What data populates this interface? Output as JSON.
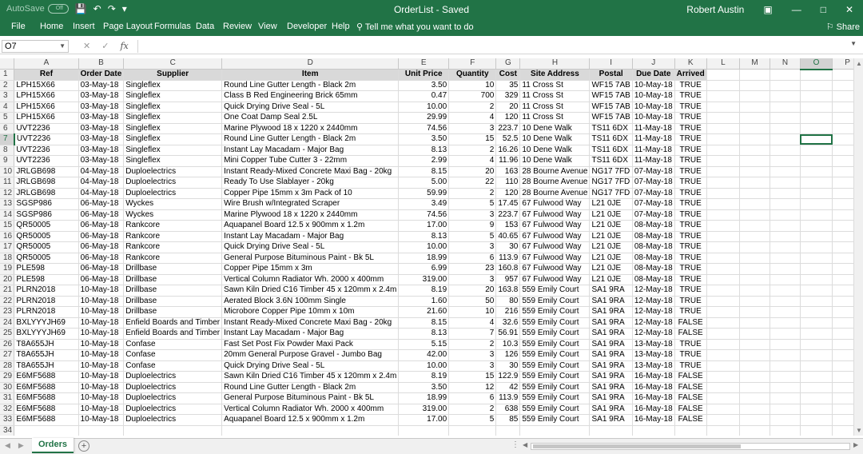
{
  "titlebar": {
    "autosave_label": "AutoSave",
    "autosave_state": "Off",
    "doc_title": "OrderList",
    "save_state": "Saved",
    "user": "Robert Austin"
  },
  "ribbon": {
    "tabs": [
      "File",
      "Home",
      "Insert",
      "Page Layout",
      "Formulas",
      "Data",
      "Review",
      "View",
      "Developer",
      "Help"
    ],
    "tell_me": "Tell me what you want to do",
    "share": "Share"
  },
  "formula_bar": {
    "name_box": "O7",
    "formula": ""
  },
  "columns": [
    "A",
    "B",
    "C",
    "D",
    "E",
    "F",
    "G",
    "H",
    "I",
    "J",
    "K",
    "L",
    "M",
    "N",
    "O",
    "P"
  ],
  "selected": {
    "col": "O",
    "row": 7
  },
  "headers": [
    "Ref",
    "Order Date",
    "Supplier",
    "Item",
    "Unit Price",
    "Quantity",
    "Cost",
    "Site Address",
    "Postal",
    "Due Date",
    "Arrived"
  ],
  "rows": [
    [
      "LPH15X66",
      "03-May-18",
      "Singleflex",
      "Round Line Gutter Length - Black 2m",
      "3.50",
      "10",
      "35",
      "11 Cross St",
      "WF15 7AB",
      "10-May-18",
      "TRUE"
    ],
    [
      "LPH15X66",
      "03-May-18",
      "Singleflex",
      "Class B Red Engineering Brick 65mm",
      "0.47",
      "700",
      "329",
      "11 Cross St",
      "WF15 7AB",
      "10-May-18",
      "TRUE"
    ],
    [
      "LPH15X66",
      "03-May-18",
      "Singleflex",
      "Quick Drying Drive Seal - 5L",
      "10.00",
      "2",
      "20",
      "11 Cross St",
      "WF15 7AB",
      "10-May-18",
      "TRUE"
    ],
    [
      "LPH15X66",
      "03-May-18",
      "Singleflex",
      "One Coat Damp Seal 2.5L",
      "29.99",
      "4",
      "120",
      "11 Cross St",
      "WF15 7AB",
      "10-May-18",
      "TRUE"
    ],
    [
      "UVT2236",
      "03-May-18",
      "Singleflex",
      "Marine Plywood 18 x 1220 x 2440mm",
      "74.56",
      "3",
      "223.7",
      "10 Dene Walk",
      "TS11 6DX",
      "11-May-18",
      "TRUE"
    ],
    [
      "UVT2236",
      "03-May-18",
      "Singleflex",
      "Round Line Gutter Length - Black 2m",
      "3.50",
      "15",
      "52.5",
      "10 Dene Walk",
      "TS11 6DX",
      "11-May-18",
      "TRUE"
    ],
    [
      "UVT2236",
      "03-May-18",
      "Singleflex",
      "Instant Lay Macadam - Major Bag",
      "8.13",
      "2",
      "16.26",
      "10 Dene Walk",
      "TS11 6DX",
      "11-May-18",
      "TRUE"
    ],
    [
      "UVT2236",
      "03-May-18",
      "Singleflex",
      "Mini Copper Tube Cutter 3 - 22mm",
      "2.99",
      "4",
      "11.96",
      "10 Dene Walk",
      "TS11 6DX",
      "11-May-18",
      "TRUE"
    ],
    [
      "JRLGB698",
      "04-May-18",
      "Duploelectrics",
      "Instant Ready-Mixed Concrete Maxi Bag - 20kg",
      "8.15",
      "20",
      "163",
      "28 Bourne Avenue",
      "NG17 7FD",
      "07-May-18",
      "TRUE"
    ],
    [
      "JRLGB698",
      "04-May-18",
      "Duploelectrics",
      "Ready To Use Slablayer - 20kg",
      "5.00",
      "22",
      "110",
      "28 Bourne Avenue",
      "NG17 7FD",
      "07-May-18",
      "TRUE"
    ],
    [
      "JRLGB698",
      "04-May-18",
      "Duploelectrics",
      "Copper Pipe 15mm x 3m Pack of 10",
      "59.99",
      "2",
      "120",
      "28 Bourne Avenue",
      "NG17 7FD",
      "07-May-18",
      "TRUE"
    ],
    [
      "SGSP986",
      "06-May-18",
      "Wyckes",
      "Wire Brush w/Integrated Scraper",
      "3.49",
      "5",
      "17.45",
      "67 Fulwood Way",
      "L21 0JE",
      "07-May-18",
      "TRUE"
    ],
    [
      "SGSP986",
      "06-May-18",
      "Wyckes",
      "Marine Plywood 18 x 1220 x 2440mm",
      "74.56",
      "3",
      "223.7",
      "67 Fulwood Way",
      "L21 0JE",
      "07-May-18",
      "TRUE"
    ],
    [
      "QR50005",
      "06-May-18",
      "Rankcore",
      "Aquapanel Board 12.5 x 900mm x 1.2m",
      "17.00",
      "9",
      "153",
      "67 Fulwood Way",
      "L21 0JE",
      "08-May-18",
      "TRUE"
    ],
    [
      "QR50005",
      "06-May-18",
      "Rankcore",
      "Instant Lay Macadam - Major Bag",
      "8.13",
      "5",
      "40.65",
      "67 Fulwood Way",
      "L21 0JE",
      "08-May-18",
      "TRUE"
    ],
    [
      "QR50005",
      "06-May-18",
      "Rankcore",
      "Quick Drying Drive Seal - 5L",
      "10.00",
      "3",
      "30",
      "67 Fulwood Way",
      "L21 0JE",
      "08-May-18",
      "TRUE"
    ],
    [
      "QR50005",
      "06-May-18",
      "Rankcore",
      "General Purpose Bituminous Paint - Bk 5L",
      "18.99",
      "6",
      "113.9",
      "67 Fulwood Way",
      "L21 0JE",
      "08-May-18",
      "TRUE"
    ],
    [
      "PLE598",
      "06-May-18",
      "Drillbase",
      "Copper Pipe 15mm x 3m",
      "6.99",
      "23",
      "160.8",
      "67 Fulwood Way",
      "L21 0JE",
      "08-May-18",
      "TRUE"
    ],
    [
      "PLE598",
      "06-May-18",
      "Drillbase",
      "Vertical Column Radiator Wh. 2000 x 400mm",
      "319.00",
      "3",
      "957",
      "67 Fulwood Way",
      "L21 0JE",
      "08-May-18",
      "TRUE"
    ],
    [
      "PLRN2018",
      "10-May-18",
      "Drillbase",
      "Sawn Kiln Dried C16 Timber 45 x 120mm x 2.4m",
      "8.19",
      "20",
      "163.8",
      "559 Emily Court",
      "SA1 9RA",
      "12-May-18",
      "TRUE"
    ],
    [
      "PLRN2018",
      "10-May-18",
      "Drillbase",
      "Aerated Block 3.6N 100mm Single",
      "1.60",
      "50",
      "80",
      "559 Emily Court",
      "SA1 9RA",
      "12-May-18",
      "TRUE"
    ],
    [
      "PLRN2018",
      "10-May-18",
      "Drillbase",
      "Microbore Copper Pipe 10mm x 10m",
      "21.60",
      "10",
      "216",
      "559 Emily Court",
      "SA1 9RA",
      "12-May-18",
      "TRUE"
    ],
    [
      "BXLYYYJH69",
      "10-May-18",
      "Enfield Boards and Timber",
      "Instant Ready-Mixed Concrete Maxi Bag - 20kg",
      "8.15",
      "4",
      "32.6",
      "559 Emily Court",
      "SA1 9RA",
      "12-May-18",
      "FALSE"
    ],
    [
      "BXLYYYJH69",
      "10-May-18",
      "Enfield Boards and Timber",
      "Instant Lay Macadam - Major Bag",
      "8.13",
      "7",
      "56.91",
      "559 Emily Court",
      "SA1 9RA",
      "12-May-18",
      "FALSE"
    ],
    [
      "T8A655JH",
      "10-May-18",
      "Confase",
      "Fast Set Post Fix Powder Maxi Pack",
      "5.15",
      "2",
      "10.3",
      "559 Emily Court",
      "SA1 9RA",
      "13-May-18",
      "TRUE"
    ],
    [
      "T8A655JH",
      "10-May-18",
      "Confase",
      "20mm General Purpose Gravel - Jumbo Bag",
      "42.00",
      "3",
      "126",
      "559 Emily Court",
      "SA1 9RA",
      "13-May-18",
      "TRUE"
    ],
    [
      "T8A655JH",
      "10-May-18",
      "Confase",
      "Quick Drying Drive Seal - 5L",
      "10.00",
      "3",
      "30",
      "559 Emily Court",
      "SA1 9RA",
      "13-May-18",
      "TRUE"
    ],
    [
      "E6MF5688",
      "10-May-18",
      "Duploelectrics",
      "Sawn Kiln Dried C16 Timber 45 x 120mm x 2.4m",
      "8.19",
      "15",
      "122.9",
      "559 Emily Court",
      "SA1 9RA",
      "16-May-18",
      "FALSE"
    ],
    [
      "E6MF5688",
      "10-May-18",
      "Duploelectrics",
      "Round Line Gutter Length - Black 2m",
      "3.50",
      "12",
      "42",
      "559 Emily Court",
      "SA1 9RA",
      "16-May-18",
      "FALSE"
    ],
    [
      "E6MF5688",
      "10-May-18",
      "Duploelectrics",
      "General Purpose Bituminous Paint - Bk 5L",
      "18.99",
      "6",
      "113.9",
      "559 Emily Court",
      "SA1 9RA",
      "16-May-18",
      "FALSE"
    ],
    [
      "E6MF5688",
      "10-May-18",
      "Duploelectrics",
      "Vertical Column Radiator Wh. 2000 x 400mm",
      "319.00",
      "2",
      "638",
      "559 Emily Court",
      "SA1 9RA",
      "16-May-18",
      "FALSE"
    ],
    [
      "E6MF5688",
      "10-May-18",
      "Duploelectrics",
      "Aquapanel Board 12.5 x 900mm x 1.2m",
      "17.00",
      "5",
      "85",
      "559 Emily Court",
      "SA1 9RA",
      "16-May-18",
      "FALSE"
    ]
  ],
  "sheet_tabs": [
    "Orders"
  ],
  "icons": {
    "save": "save-icon",
    "undo": "undo-icon",
    "redo": "redo-icon",
    "search": "lightbulb-search-icon"
  },
  "colors": {
    "accent": "#217346",
    "header_fill": "#d9d9d9"
  }
}
